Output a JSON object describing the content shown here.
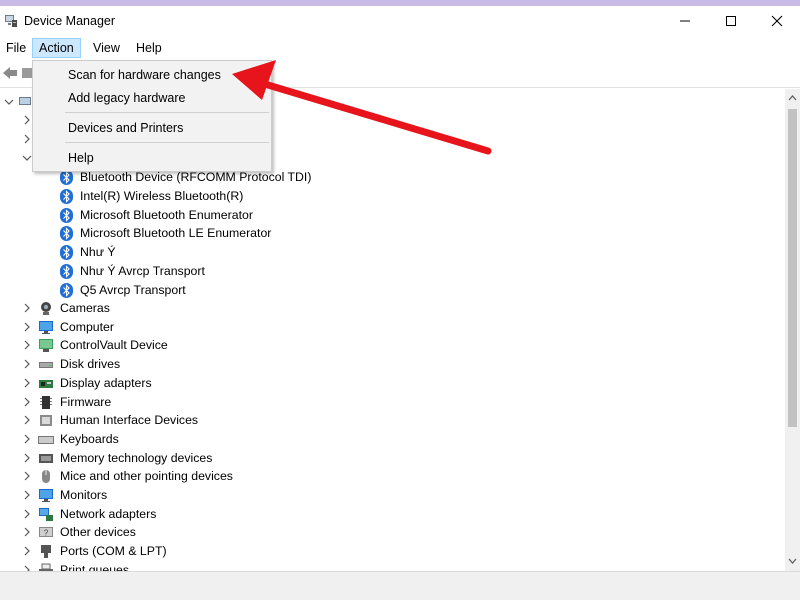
{
  "window": {
    "title": "Device Manager",
    "app_icon": "device-manager-icon",
    "controls": [
      "minimize-icon",
      "maximize-icon",
      "close-icon"
    ]
  },
  "menubar": {
    "items": [
      {
        "label": "File"
      },
      {
        "label": "Action",
        "active": true
      },
      {
        "label": "View"
      },
      {
        "label": "Help"
      }
    ]
  },
  "toolbar": {
    "icons": [
      "back-arrow-icon",
      "forward-icon"
    ]
  },
  "action_menu": {
    "items": [
      {
        "label": "Scan for hardware changes"
      },
      {
        "label": "Add legacy hardware"
      },
      {
        "label": "Devices and Printers"
      },
      {
        "label": "Help"
      }
    ]
  },
  "tree": {
    "bluetooth_children": [
      {
        "label": "Bluetooth Device (RFCOMM Protocol TDI)",
        "icon": "bluetooth-icon"
      },
      {
        "label": "Intel(R) Wireless Bluetooth(R)",
        "icon": "bluetooth-icon"
      },
      {
        "label": "Microsoft Bluetooth Enumerator",
        "icon": "bluetooth-icon"
      },
      {
        "label": "Microsoft Bluetooth LE Enumerator",
        "icon": "bluetooth-icon"
      },
      {
        "label": "Như Ý",
        "icon": "bluetooth-icon"
      },
      {
        "label": "Như Ý Avrcp Transport",
        "icon": "bluetooth-icon"
      },
      {
        "label": "Q5 Avrcp Transport",
        "icon": "bluetooth-icon"
      }
    ],
    "categories": [
      {
        "label": "Cameras",
        "icon": "camera-icon"
      },
      {
        "label": "Computer",
        "icon": "monitor-icon"
      },
      {
        "label": "ControlVault Device",
        "icon": "controlvault-icon"
      },
      {
        "label": "Disk drives",
        "icon": "disk-drive-icon"
      },
      {
        "label": "Display adapters",
        "icon": "display-adapter-icon"
      },
      {
        "label": "Firmware",
        "icon": "firmware-icon"
      },
      {
        "label": "Human Interface Devices",
        "icon": "hid-icon"
      },
      {
        "label": "Keyboards",
        "icon": "keyboard-icon"
      },
      {
        "label": "Memory technology devices",
        "icon": "memory-icon"
      },
      {
        "label": "Mice and other pointing devices",
        "icon": "mouse-icon"
      },
      {
        "label": "Monitors",
        "icon": "monitor-icon"
      },
      {
        "label": "Network adapters",
        "icon": "network-adapter-icon"
      },
      {
        "label": "Other devices",
        "icon": "other-devices-icon"
      },
      {
        "label": "Ports (COM & LPT)",
        "icon": "port-icon"
      },
      {
        "label": "Print queues",
        "icon": "printer-icon"
      }
    ]
  },
  "colors": {
    "accent_menu": "#cce8ff",
    "bluetooth": "#1f6fd6",
    "annotation_arrow": "#e8141c"
  },
  "annotation": "red-arrow-pointing-to-scan-for-hardware-changes"
}
